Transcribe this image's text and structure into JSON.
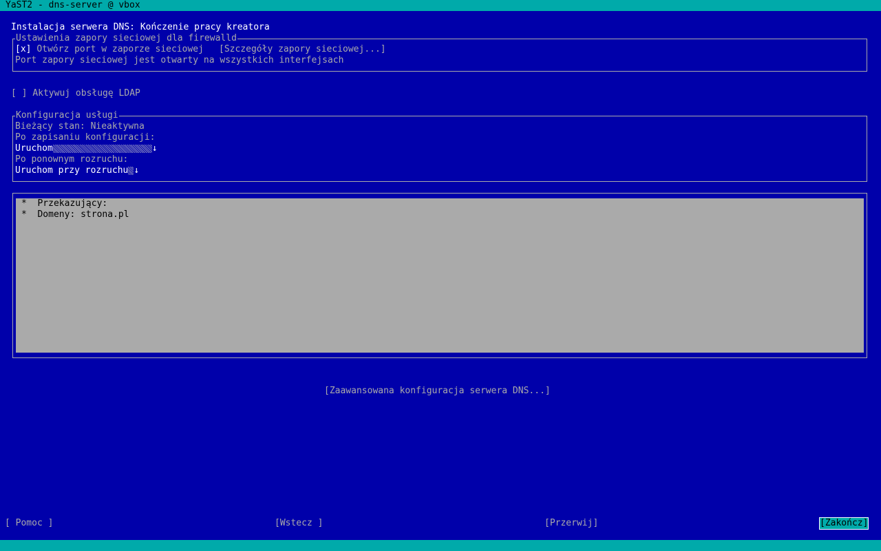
{
  "window": {
    "title": "YaST2 - dns-server @ vbox"
  },
  "page": {
    "title": "Instalacja serwera DNS: Kończenie pracy kreatora"
  },
  "firewall": {
    "legend": "Ustawienia zapory sieciowej dla firewalld",
    "open_port_checkbox_mark": "[x]",
    "open_port_label": "Otwórz port w zaporze sieciowej",
    "details_button": "[Szczegóły zapory sieciowej...]",
    "status_text": "Port zapory sieciowej jest otwarty na wszystkich interfejsach"
  },
  "ldap": {
    "checkbox_mark": "[ ]",
    "label": "Aktywuj obsługę LDAP"
  },
  "service": {
    "legend": "Konfiguracja usługi",
    "current_state": "Bieżący stan: Nieaktywna",
    "after_save_label": "Po zapisaniu konfiguracji:",
    "after_save_value": "Uruchom",
    "after_reboot_label": "Po ponownym rozruchu:",
    "after_reboot_value": "Uruchom przy rozruchu",
    "dropdown_arrow": "↓"
  },
  "summary": {
    "items": [
      {
        "bullet": "*",
        "text": "Przekazujący:"
      },
      {
        "bullet": "*",
        "text": "Domeny: strona.pl"
      }
    ]
  },
  "advanced_button": "[Zaawansowana konfiguracja serwera DNS...]",
  "footer": {
    "help": "[ Pomoc ]",
    "back": "[Wstecz ]",
    "abort": "[Przerwij]",
    "finish": "[Zakończ]"
  }
}
